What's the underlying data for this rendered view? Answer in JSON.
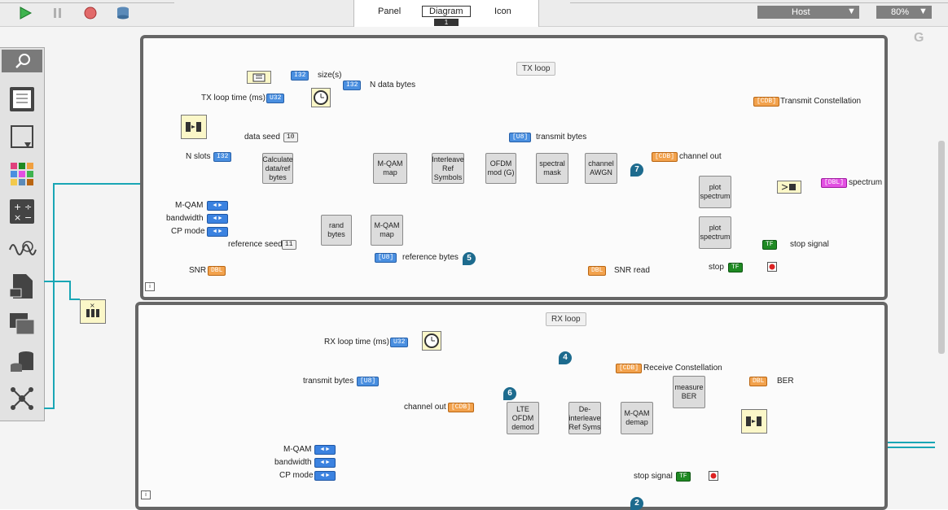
{
  "toolbar": {
    "view_tabs": [
      "Panel",
      "Diagram",
      "Icon"
    ],
    "diagram_badge": "1",
    "target_select": "Host",
    "zoom_select": "80%",
    "right_letter": "G"
  },
  "tx_loop": {
    "title": "TX loop",
    "tx_loop_time_label": "TX loop time (ms)",
    "size_label": "size(s)",
    "n_data_bytes_label": "N data bytes",
    "data_seed_label": "data seed",
    "data_seed_value": "10",
    "n_slots_label": "N slots",
    "m_qam_label": "M-QAM",
    "bandwidth_label": "bandwidth",
    "cp_mode_label": "CP mode",
    "reference_seed_label": "reference seed",
    "reference_seed_value": "11",
    "snr_label": "SNR",
    "reference_bytes_label": "reference bytes",
    "transmit_constellation_label": "Transmit Constellation",
    "transmit_bytes_label": "transmit bytes",
    "channel_out_label": "channel out",
    "spectrum_label": "spectrum",
    "stop_signal_label": "stop signal",
    "stop_label": "stop",
    "snr_read_label": "SNR read",
    "blocks": {
      "calc": "Calculate data/ref bytes",
      "mqam_map_1": "M-QAM map",
      "rand_bytes": "rand bytes",
      "mqam_map_2": "M-QAM map",
      "interleave": "Interleave Ref Symbols",
      "ofdm_mod": "OFDM mod (G)",
      "spectral_mask": "spectral mask",
      "channel_awgn": "channel AWGN",
      "plot_spectrum_1": "plot spectrum",
      "plot_spectrum_2": "plot spectrum"
    },
    "pins": {
      "p5": "5",
      "p7": "7"
    }
  },
  "rx_loop": {
    "title": "RX loop",
    "rx_loop_time_label": "RX loop time (ms)",
    "transmit_bytes_label": "transmit bytes",
    "channel_out_label": "channel out",
    "m_qam_label": "M-QAM",
    "bandwidth_label": "bandwidth",
    "cp_mode_label": "CP mode",
    "receive_constellation_label": "Receive Constellation",
    "ber_label": "BER",
    "stop_signal_label": "stop signal",
    "blocks": {
      "lte_demod": "LTE OFDM demod",
      "deinterleave": "De-interleave Ref Syms",
      "mqam_demap": "M-QAM demap",
      "measure_ber": "measure BER"
    },
    "pins": {
      "p4": "4",
      "p6": "6",
      "p2": "2"
    }
  },
  "terminal_types": {
    "u32": "U32",
    "i32": "I32",
    "u8": "[U8]",
    "dbl": "DBL",
    "cdb": "[CDB]",
    "tf": "TF",
    "cdb_mag": "[DBL]"
  },
  "colors": {
    "loop_border": "#666666",
    "wire_blue": "#4a8fe0",
    "wire_orange": "#f0a040",
    "wire_magenta": "#e24fe2",
    "wire_green": "#1f8a23",
    "wire_teal": "#19a6b5"
  }
}
